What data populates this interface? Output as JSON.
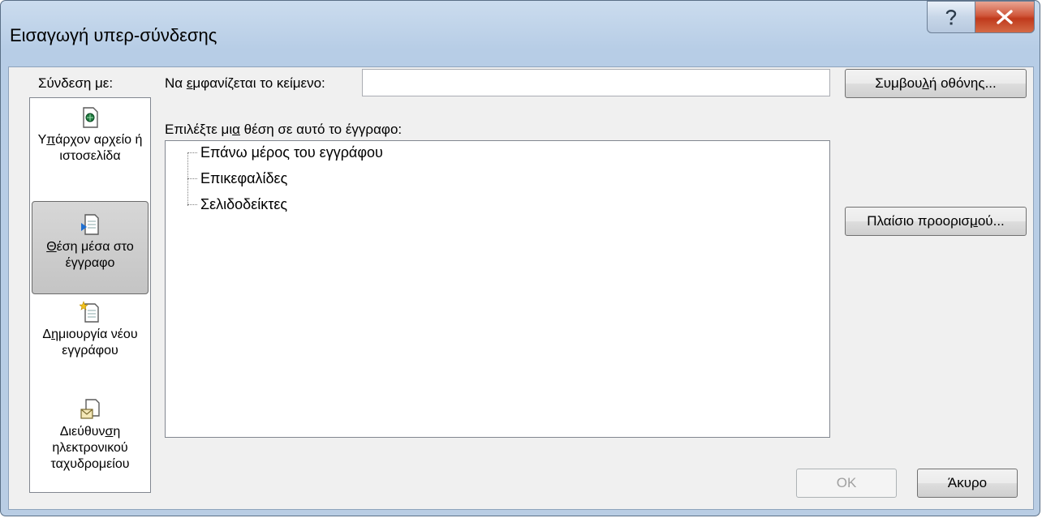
{
  "window": {
    "title": "Εισαγωγή υπερ-σύνδεσης",
    "help_label": "?",
    "close_label": "X"
  },
  "link_to": {
    "label": "Σύνδεση με:",
    "items": [
      {
        "pre": "Υ",
        "u": "π",
        "post": "άρχον αρχείο ή ιστοσελίδα",
        "icon": "existing-file-icon",
        "selected": false
      },
      {
        "pre": "",
        "u": "Θ",
        "post": "έση μέσα στο έγγραφο",
        "icon": "place-in-document-icon",
        "selected": true
      },
      {
        "pre": "Δ",
        "u": "η",
        "post": "μιουργία νέου εγγράφου",
        "icon": "new-document-icon",
        "selected": false
      },
      {
        "pre": "Διεύθυν",
        "u": "σ",
        "post": "η ηλεκτρονικού ταχυδρομείου",
        "icon": "email-address-icon",
        "selected": false
      }
    ]
  },
  "text_to_display": {
    "pre": "Να ",
    "u": "ε",
    "post": "μφανίζεται το κείμενο:",
    "value": ""
  },
  "screentip_button": {
    "pre": "Συμβου",
    "u": "λ",
    "post": "ή οθόνης..."
  },
  "place_select": {
    "pre": "Επιλέξτε μι",
    "u": "α",
    "post": " θέση σε αυτό το έγγραφο:",
    "items": [
      "Επάνω μέρος του εγγράφου",
      "Επικεφαλίδες",
      "Σελιδοδείκτες"
    ]
  },
  "target_frame_button": {
    "pre": "Πλαίσιο προορισ",
    "u": "μ",
    "post": "ού..."
  },
  "ok_button": "OK",
  "cancel_button": "Άκυρο"
}
